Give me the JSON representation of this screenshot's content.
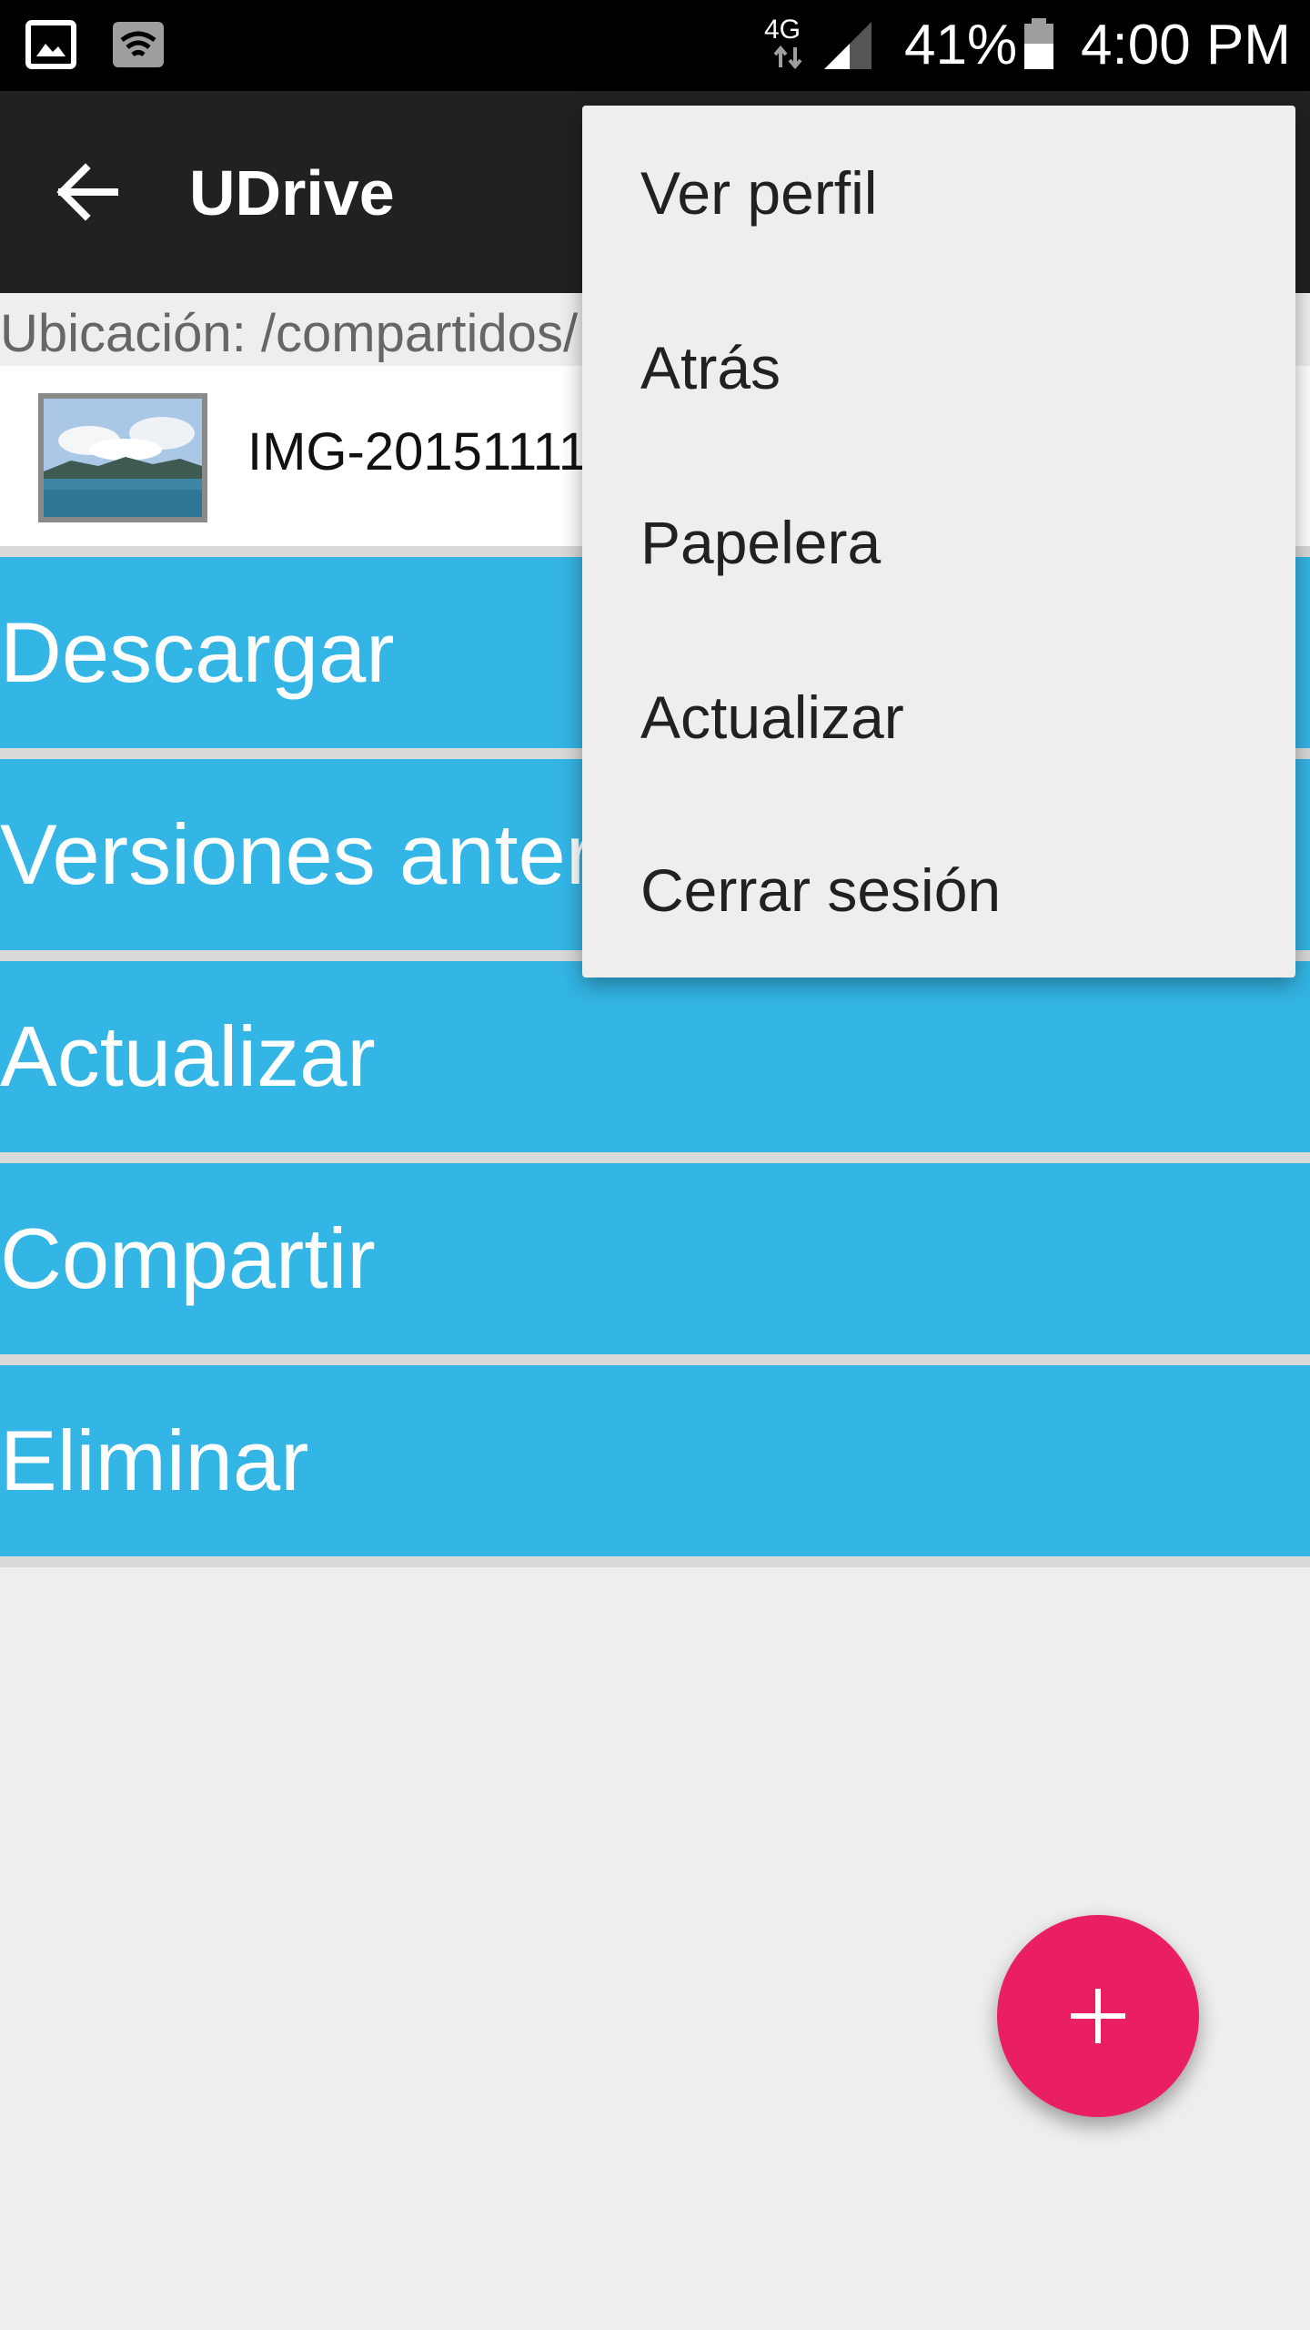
{
  "status_bar": {
    "network": "4G",
    "battery": "41%",
    "time": "4:00 PM",
    "icons": [
      "gallery-icon",
      "wifi-icon",
      "signal-icon",
      "battery-icon"
    ]
  },
  "app_bar": {
    "title": "UDrive"
  },
  "location": {
    "text": "Ubicación: /compartidos/"
  },
  "file": {
    "name": "IMG-20151111"
  },
  "actions": [
    {
      "label": "Descargar"
    },
    {
      "label": "Versiones anteriores"
    },
    {
      "label": "Actualizar"
    },
    {
      "label": "Compartir"
    },
    {
      "label": "Eliminar"
    }
  ],
  "menu": {
    "items": [
      {
        "label": "Ver perfil"
      },
      {
        "label": "Atrás"
      },
      {
        "label": "Papelera"
      },
      {
        "label": "Actualizar"
      },
      {
        "label": "Cerrar sesión"
      }
    ]
  },
  "colors": {
    "action_blue": "#33b5e5",
    "fab_pink": "#e91e63",
    "app_bar": "#212121"
  }
}
